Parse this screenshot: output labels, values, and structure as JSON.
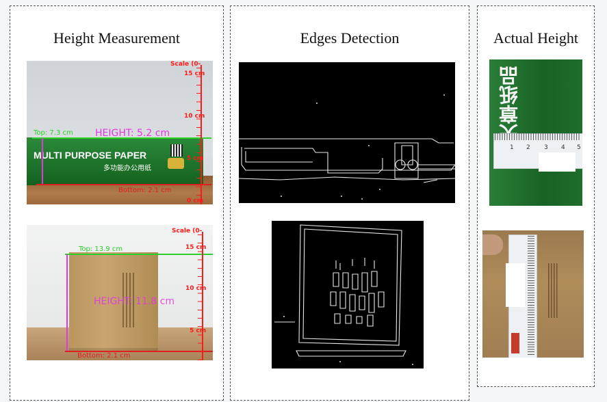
{
  "panels": {
    "height_measurement": {
      "title": "Height Measurement",
      "img1": {
        "top_label": "Top: 7.3 cm",
        "height_label": "HEIGHT: 5.2 cm",
        "bottom_label": "Bottom: 2.1 cm",
        "box_text1": "MULTI PURPOSE PAPER",
        "box_text2": "多功能办公用纸",
        "scale_title": "Scale (0-",
        "scale_ticks": [
          "15 cm",
          "10 cm",
          "5 cm",
          "0 cm"
        ]
      },
      "img2": {
        "top_label": "Top: 13.9 cm",
        "height_label": "HEIGHT: 11.8 cm",
        "bottom_label": "Bottom: 2.1 cm",
        "scale_title": "Scale (0-",
        "scale_ticks": [
          "15 cm",
          "10 cm",
          "5 cm"
        ]
      }
    },
    "edges_detection": {
      "title": "Edges Detection"
    },
    "actual_height": {
      "title": "Actual Height",
      "ruler_numbers": [
        "1",
        "2",
        "3",
        "4",
        "5"
      ],
      "box_brand": "天章纸品"
    }
  },
  "colors": {
    "measurement_line": "#e236e2",
    "top_line": "#2bd02b",
    "bottom_line": "#e02020",
    "scale": "#ff1a1a",
    "paper_box": "#1d6b2a",
    "cardboard": "#b08c55"
  }
}
